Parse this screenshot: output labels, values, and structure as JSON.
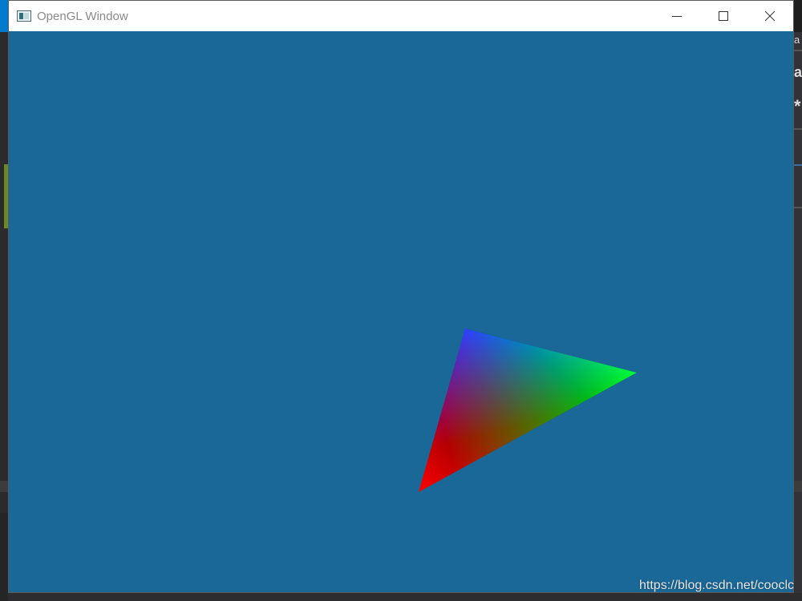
{
  "window": {
    "title": "OpenGL Window",
    "clear_color": "#1a6898",
    "icon": "opengl-app-icon",
    "controls": {
      "minimize_icon": "minimize-icon",
      "maximize_icon": "maximize-icon",
      "close_icon": "close-icon"
    }
  },
  "scene": {
    "shape": "triangle",
    "vertex_colors": {
      "top": "#0000ff",
      "right": "#00ff00",
      "bottom_left": "#ff0000"
    }
  },
  "watermark": {
    "text": "https://blog.csdn.net/cooclc"
  },
  "background_fragments": {
    "right_chars": [
      "a",
      "a",
      "*"
    ]
  }
}
